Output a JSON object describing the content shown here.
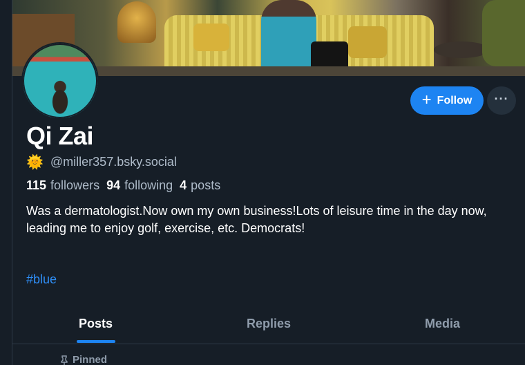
{
  "profile": {
    "display_name": "Qi Zai",
    "handle_icon": "🌞",
    "handle_icon_name": "sun-behind-horizon-icon",
    "handle": "@miller357.bsky.social",
    "stats": {
      "followers_count": "115",
      "followers_label": "followers",
      "following_count": "94",
      "following_label": "following",
      "posts_count": "4",
      "posts_label": "posts"
    },
    "bio": "Was a dermatologist.Now own my own business!Lots of leisure time in the day now, leading me to enjoy golf, exercise, etc. Democrats!",
    "hashtag": "#blue"
  },
  "actions": {
    "follow_icon": "+",
    "follow_label": "Follow",
    "more_label": "···"
  },
  "tabs": [
    {
      "label": "Posts",
      "active": true
    },
    {
      "label": "Replies",
      "active": false
    },
    {
      "label": "Media",
      "active": false
    }
  ],
  "feed": {
    "pinned_label": "Pinned"
  },
  "colors": {
    "accent": "#1d84f2",
    "background": "#161e27",
    "link": "#2f8ef6"
  }
}
